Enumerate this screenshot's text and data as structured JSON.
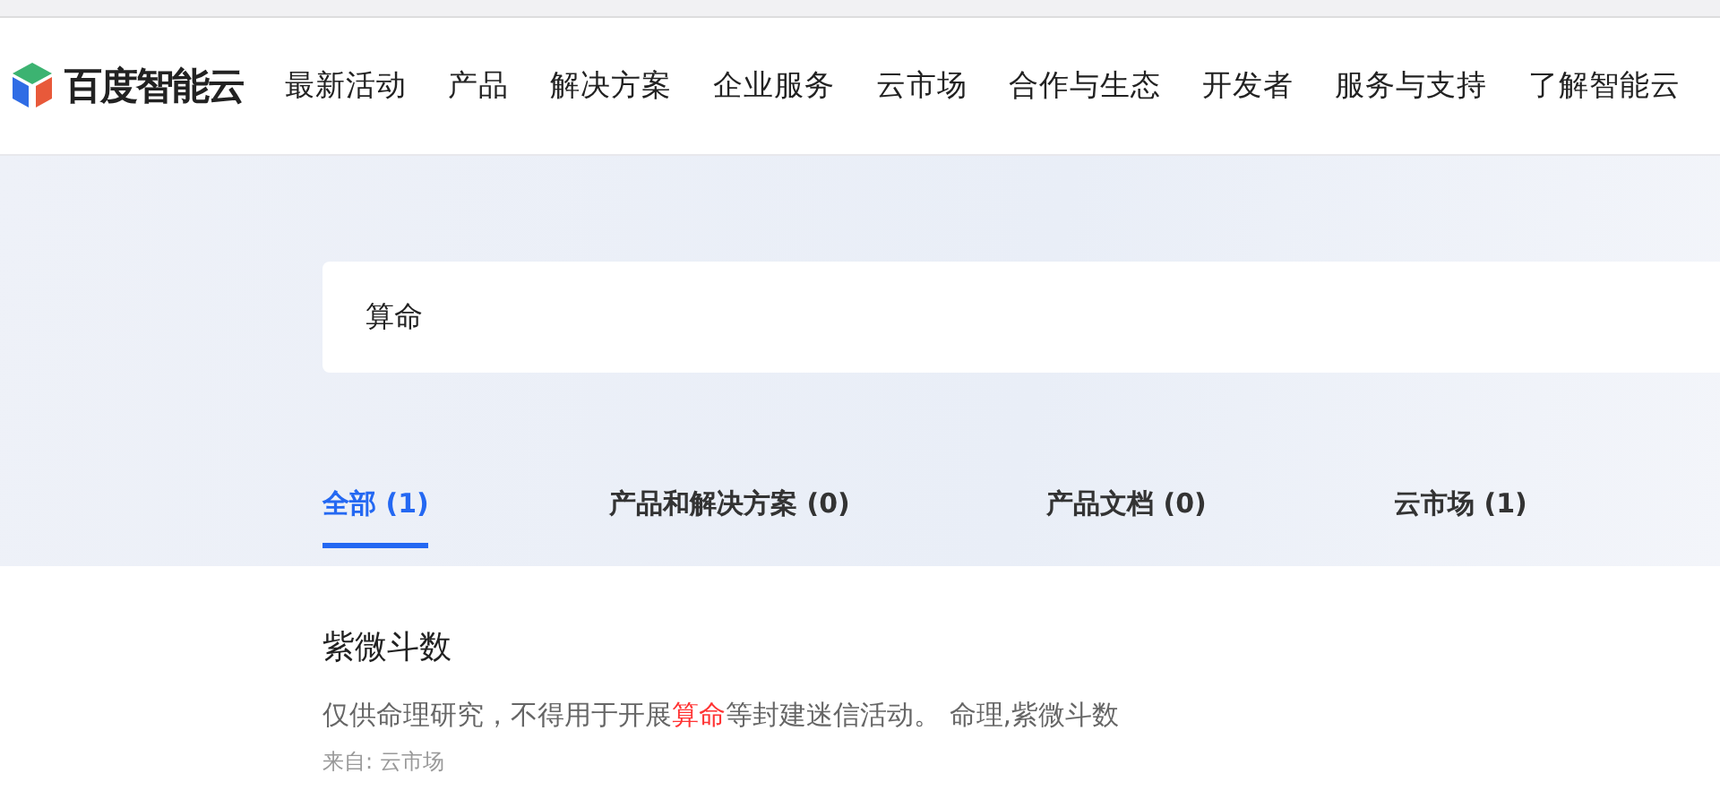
{
  "header": {
    "logo": "百度智能云",
    "nav": [
      "最新活动",
      "产品",
      "解决方案",
      "企业服务",
      "云市场",
      "合作与生态",
      "开发者",
      "服务与支持",
      "了解智能云"
    ]
  },
  "search": {
    "value": "算命"
  },
  "tabs": [
    {
      "label": "全部 (1)",
      "selected": true
    },
    {
      "label": "产品和解决方案 (0)",
      "selected": false
    },
    {
      "label": "产品文档 (0)",
      "selected": false
    },
    {
      "label": "云市场 (1)",
      "selected": false
    }
  ],
  "results": [
    {
      "title": "紫微斗数",
      "description": [
        {
          "text": "仅供命理研究，不得用于开展",
          "highlight": false
        },
        {
          "text": "算命",
          "highlight": true
        },
        {
          "text": "等封建迷信活动。 命理,紫微斗数",
          "highlight": false
        }
      ],
      "source": "来自: 云市场"
    }
  ]
}
